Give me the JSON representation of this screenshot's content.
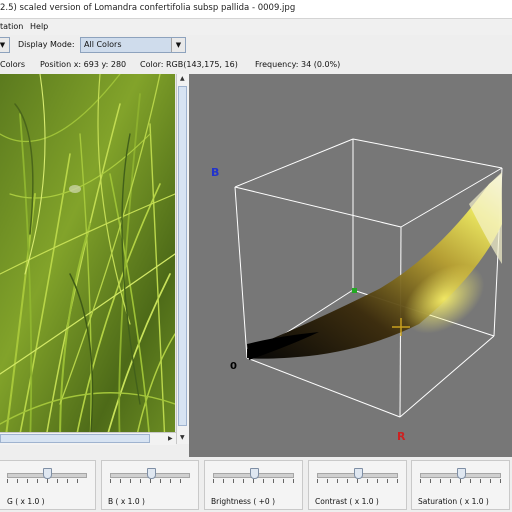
{
  "window": {
    "title": "2.5)   scaled version of Lomandra confertifolia subsp pallida - 0009.jpg"
  },
  "menu": {
    "items": [
      "tation",
      "Help"
    ]
  },
  "toolbar": {
    "display_mode_label": "Display Mode:",
    "display_mode_value": "All Colors"
  },
  "status": {
    "mode": "Colors",
    "position": "Position x: 693 y: 280",
    "color": "Color:  RGB(143,175,  16)",
    "frequency": "Frequency: 34 (0.0%)"
  },
  "cube": {
    "axis_b": "B",
    "axis_r": "R",
    "origin": "0",
    "colors": {
      "edges": "#ffffff",
      "b_label": "#2233cc",
      "r_label": "#cc2222",
      "origin": "#000000",
      "cursor": "#c8a01e",
      "green_marker": "#22aa22"
    }
  },
  "sliders": [
    {
      "label": "G  ( x 1.0 )",
      "level": 0.5
    },
    {
      "label": "B  ( x 1.0 )",
      "level": 0.5
    },
    {
      "label": "Brightness  ( +0 )",
      "level": 0.5
    },
    {
      "label": "Contrast  ( x 1.0 )",
      "level": 0.5
    },
    {
      "label": "Saturation  ( x 1.0 )",
      "level": 0.5
    }
  ]
}
